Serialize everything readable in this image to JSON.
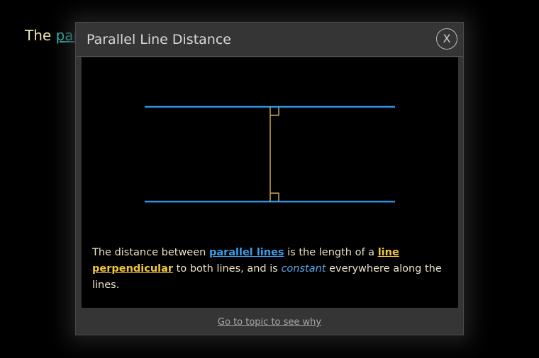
{
  "background": {
    "prefix": "The",
    "link_text": "par"
  },
  "modal": {
    "title": "Parallel Line Distance",
    "close_label": "X",
    "footer_link": "Go to topic to see why"
  },
  "caption": {
    "part1": "The distance between ",
    "term1": "parallel lines",
    "part2": " is the length of a ",
    "term2": "line perpendicular",
    "part3": " to both lines, and is ",
    "term3": "constant",
    "part4": " everywhere along the lines."
  },
  "colors": {
    "parallel_lines": "#2f8fe0",
    "perpendicular_line": "#c9a94a",
    "caption_text": "#e9e3c4",
    "accent_blue": "#3a9dea",
    "accent_yellow": "#f0c63a"
  }
}
